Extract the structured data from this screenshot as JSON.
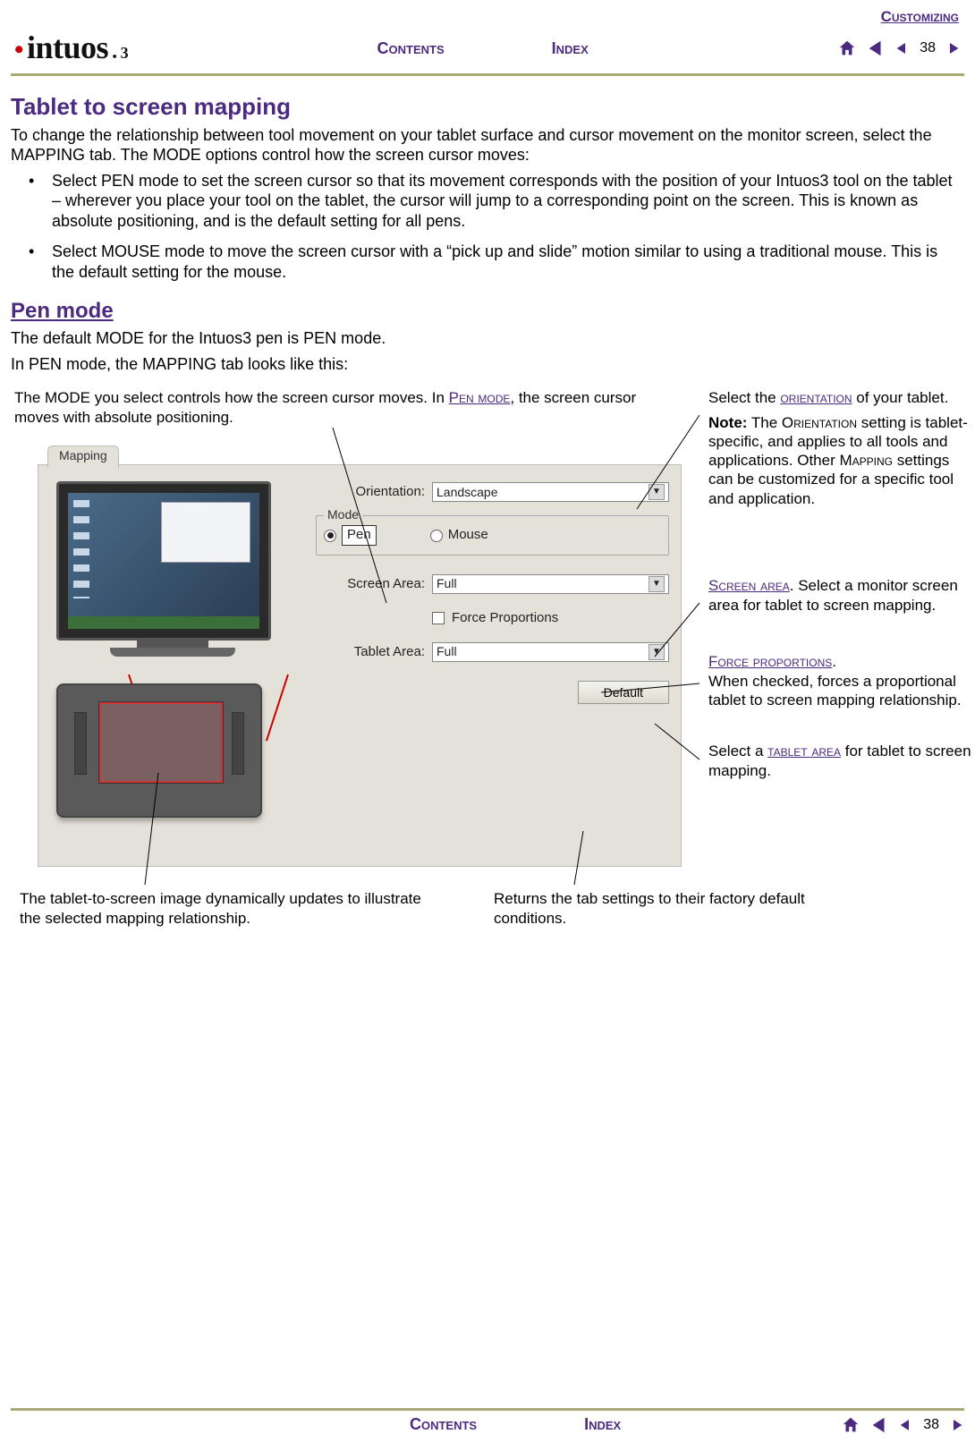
{
  "header": {
    "breadcrumb": "Customizing",
    "logo": {
      "name": "intuos",
      "sub": "3"
    },
    "nav": {
      "contents": "Contents",
      "index": "Index"
    },
    "page_number": "38"
  },
  "section": {
    "title": "Tablet to screen mapping",
    "intro": "To change the relationship between tool movement on your tablet surface and cursor movement on the monitor screen, select the MAPPING tab.  The MODE options control how the screen cursor moves:",
    "bullets": [
      "Select PEN mode to set the screen cursor so that its movement corresponds with the position of your Intuos3 tool on the tablet – wherever you place your tool on the tablet, the cursor will jump to a corresponding point on the screen.  This is known as absolute positioning, and is the default setting for all pens.",
      "Select MOUSE mode to move the screen cursor with a “pick up and slide” motion similar to using a traditional mouse.  This is the default setting for the mouse."
    ]
  },
  "subsection": {
    "title": "Pen mode",
    "line1": "The default MODE for the Intuos3 pen is PEN mode.",
    "line2": "In PEN mode, the MAPPING tab looks like this:"
  },
  "diagram": {
    "tab_label": "Mapping",
    "callout_top_left_a": "The MODE you select controls how the screen cursor moves.  In ",
    "callout_top_left_link": "Pen mode",
    "callout_top_left_b": ", the screen cursor moves with absolute positioning.",
    "right1a": "Select the ",
    "right1_link": "orientation",
    "right1b": " of your tablet.",
    "right1_note": "Note: The ORIENTATION setting is tablet-specific, and applies to all tools and applications. Other MAPPING settings can be customized for a specific tool and application.",
    "right2_link": "Screen area",
    "right2": ".  Select a monitor screen area for tablet to screen mapping.",
    "right3_link": "Force proportions",
    "right3a": ".",
    "right3b": "When checked, forces a proportional tablet to screen mapping relationship.",
    "right4a": "Select a ",
    "right4_link": "tablet area",
    "right4b": " for tablet to screen mapping.",
    "bottom_left": "The tablet-to-screen image dynamically updates to illustrate the selected mapping relationship.",
    "bottom_right": "Returns the tab settings to their factory default conditions."
  },
  "form": {
    "orientation_label": "Orientation:",
    "orientation_value": "Landscape",
    "mode_legend": "Mode",
    "mode_pen": "Pen",
    "mode_mouse": "Mouse",
    "screen_area_label": "Screen Area:",
    "screen_area_value": "Full",
    "force_proportions_label": "Force Proportions",
    "tablet_area_label": "Tablet Area:",
    "tablet_area_value": "Full",
    "default_button": "Default"
  },
  "footer": {
    "contents": "Contents",
    "index": "Index",
    "page_number": "38"
  }
}
